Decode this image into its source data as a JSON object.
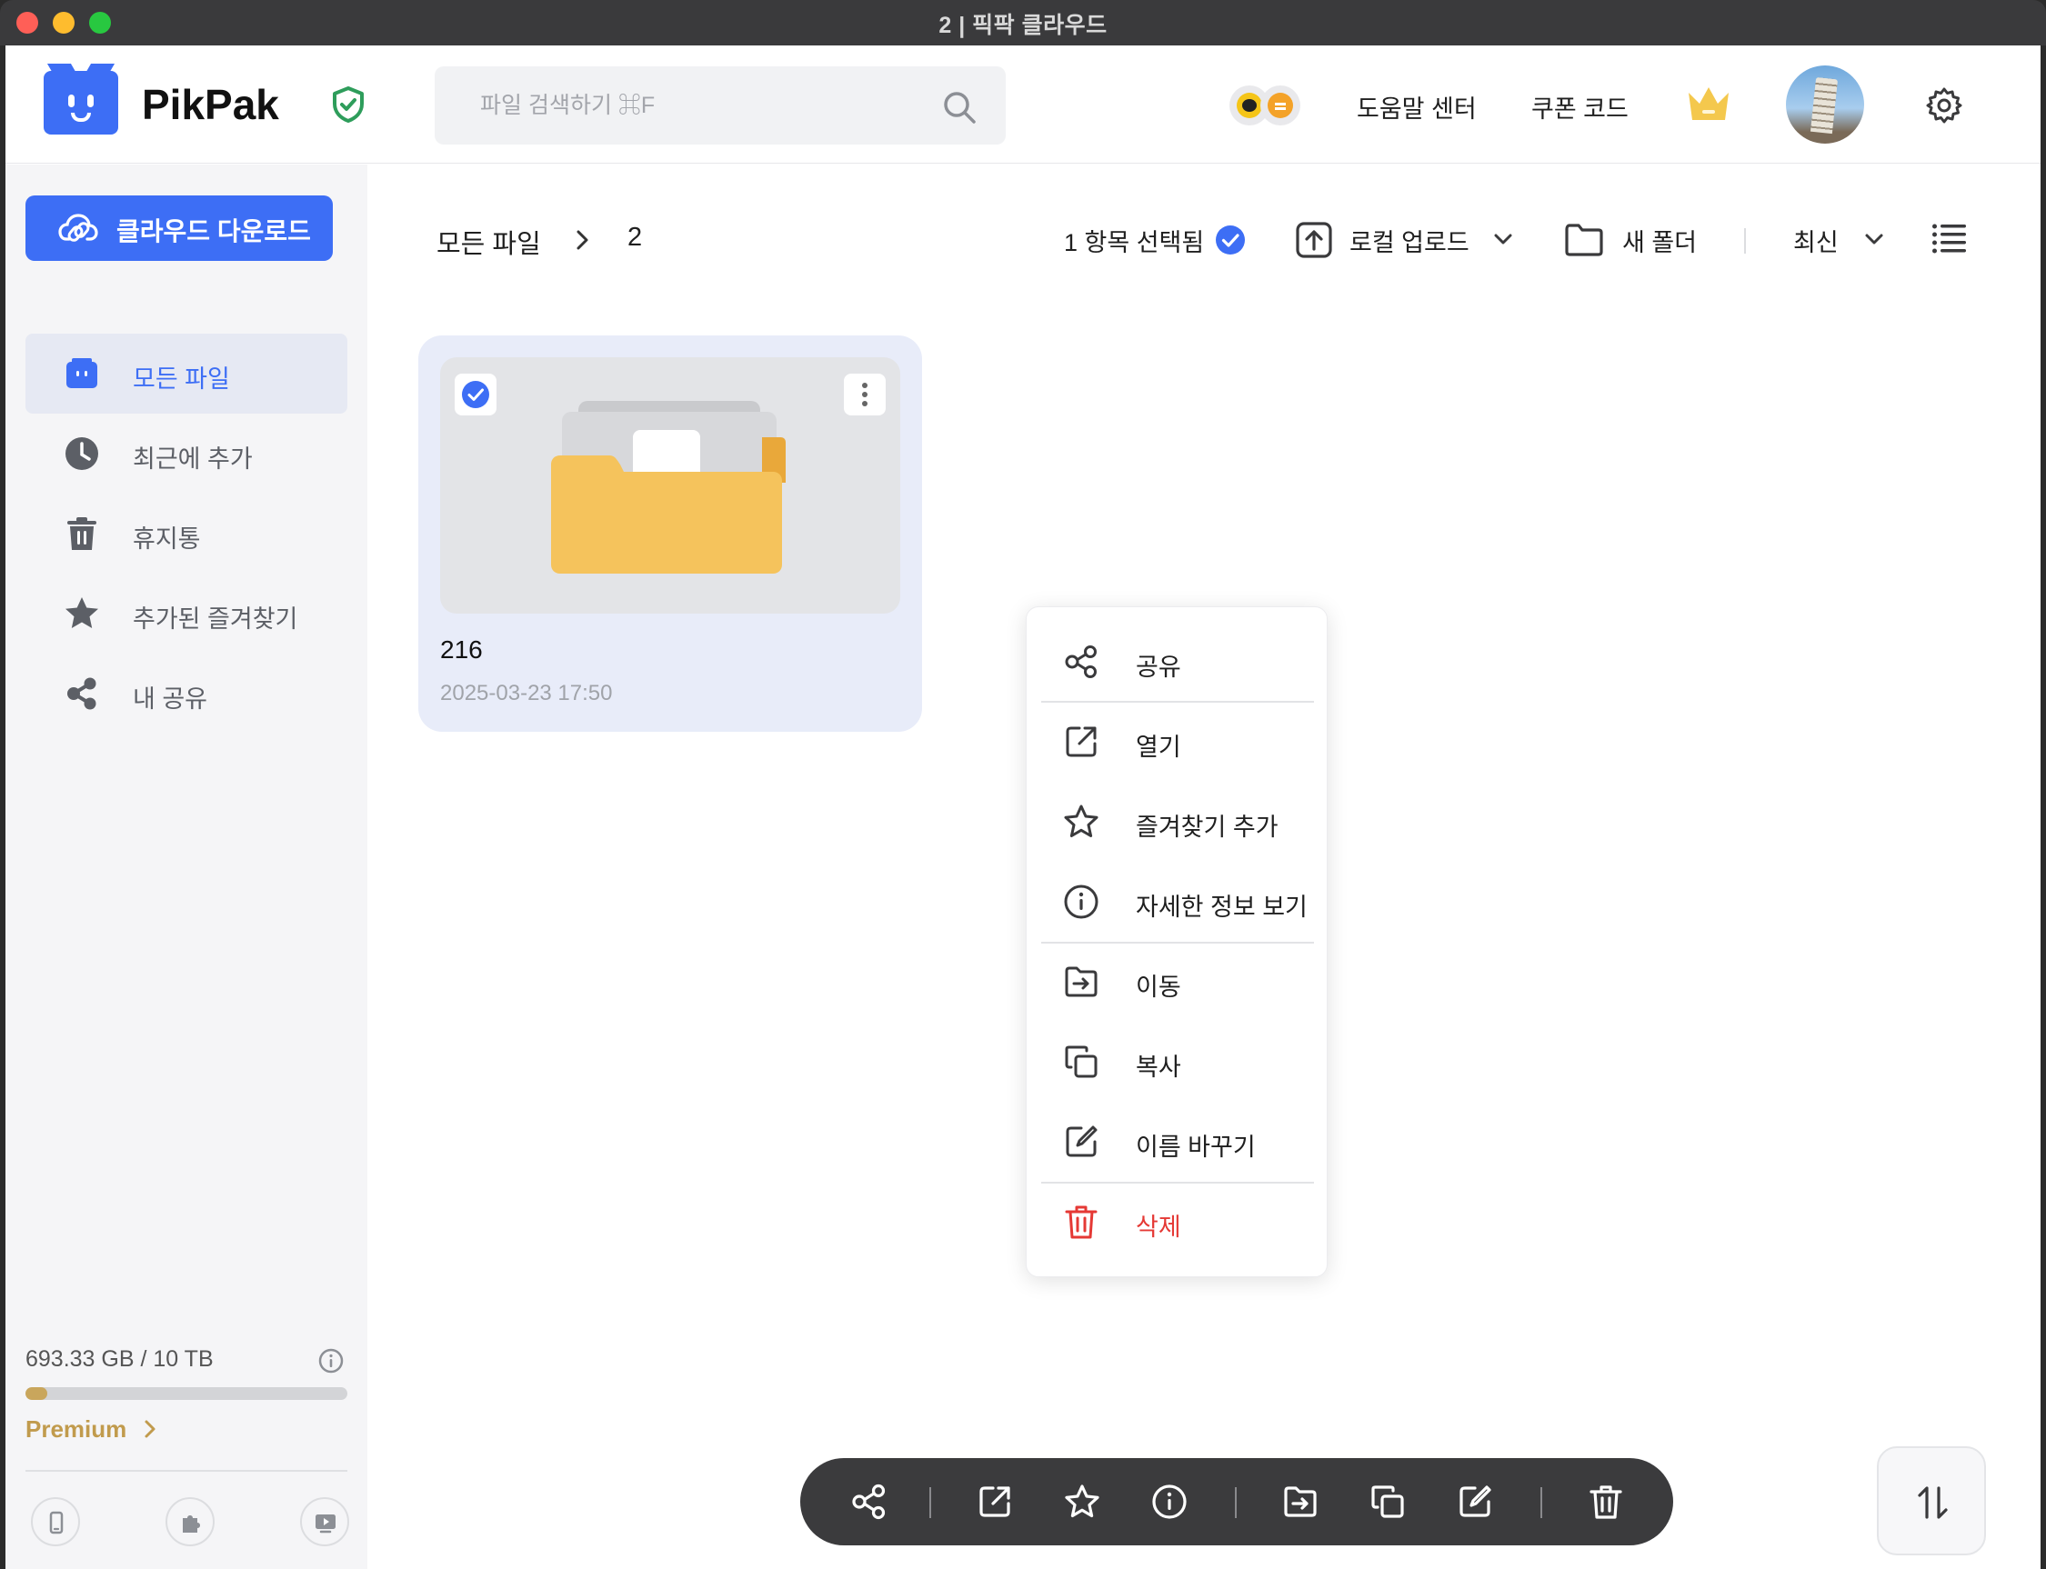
{
  "window": {
    "title": "2 | 픽팍 클라우드"
  },
  "header": {
    "brand": "PikPak",
    "search_placeholder": "파일 검색하기 ⌘F",
    "help_label": "도움말 센터",
    "coupon_label": "쿠폰 코드"
  },
  "sidebar": {
    "cloud_download": "클라우드 다운로드",
    "items": [
      {
        "label": "모든 파일",
        "icon": "all-files-icon",
        "active": true
      },
      {
        "label": "최근에 추가",
        "icon": "clock-icon"
      },
      {
        "label": "휴지통",
        "icon": "trash-icon"
      },
      {
        "label": "추가된 즐겨찾기",
        "icon": "star-icon"
      },
      {
        "label": "내 공유",
        "icon": "share-icon"
      }
    ],
    "storage": "693.33 GB / 10 TB",
    "storage_used_fraction": 0.068,
    "premium": "Premium"
  },
  "toolbar": {
    "breadcrumb_root": "모든 파일",
    "breadcrumb_current": "2",
    "selected": "1 항목 선택됨",
    "upload": "로컬 업로드",
    "new_folder": "새 폴더",
    "sort": "최신"
  },
  "file": {
    "name": "216",
    "date": "2025-03-23 17:50"
  },
  "context_menu": {
    "share": "공유",
    "open": "열기",
    "favorite": "즐겨찾기 추가",
    "details": "자세한 정보 보기",
    "move": "이동",
    "copy": "복사",
    "rename": "이름 바꾸기",
    "delete": "삭제"
  },
  "colors": {
    "accent": "#3d6ef5",
    "danger": "#e53935",
    "premium": "#c19b4d",
    "folder": "#f5c35c"
  }
}
